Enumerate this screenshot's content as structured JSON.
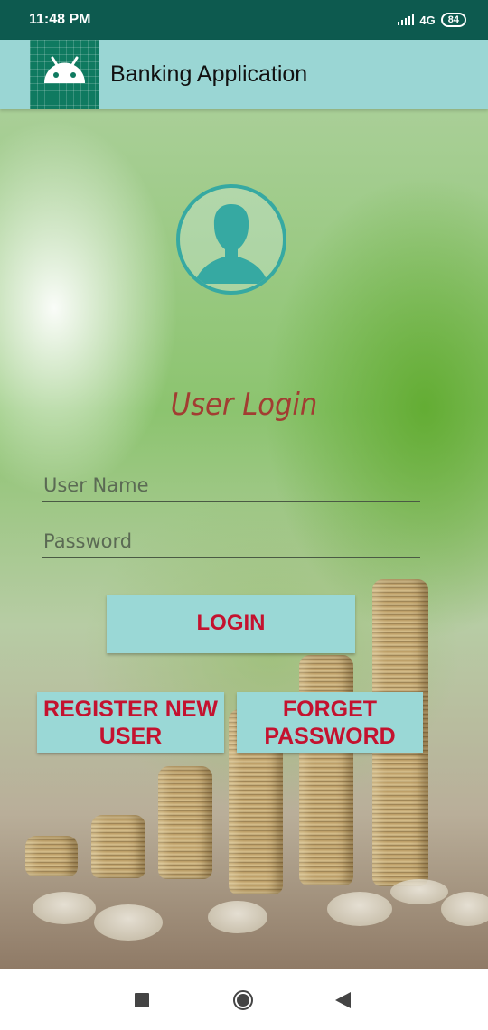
{
  "status_bar": {
    "time": "11:48 PM",
    "network": "4G",
    "battery": "84"
  },
  "app_bar": {
    "title": "Banking Application",
    "icon": "android-icon"
  },
  "login": {
    "avatar_icon": "user-avatar-icon",
    "title": "User Login",
    "username_placeholder": "User Name",
    "username_value": "",
    "password_placeholder": "Password",
    "password_value": "",
    "login_button": "LOGIN",
    "register_button": "REGISTER NEW USER",
    "forget_button": "FORGET PASSWORD"
  },
  "nav_bar": {
    "recents_icon": "square-icon",
    "home_icon": "circle-icon",
    "back_icon": "triangle-back-icon"
  },
  "colors": {
    "status_bar": "#0d5a4f",
    "app_bar": "#9ad6d4",
    "button_bg": "#9ad8d6",
    "button_text": "#c4122f",
    "title_text": "#a23d32",
    "avatar": "#36a9a2"
  }
}
